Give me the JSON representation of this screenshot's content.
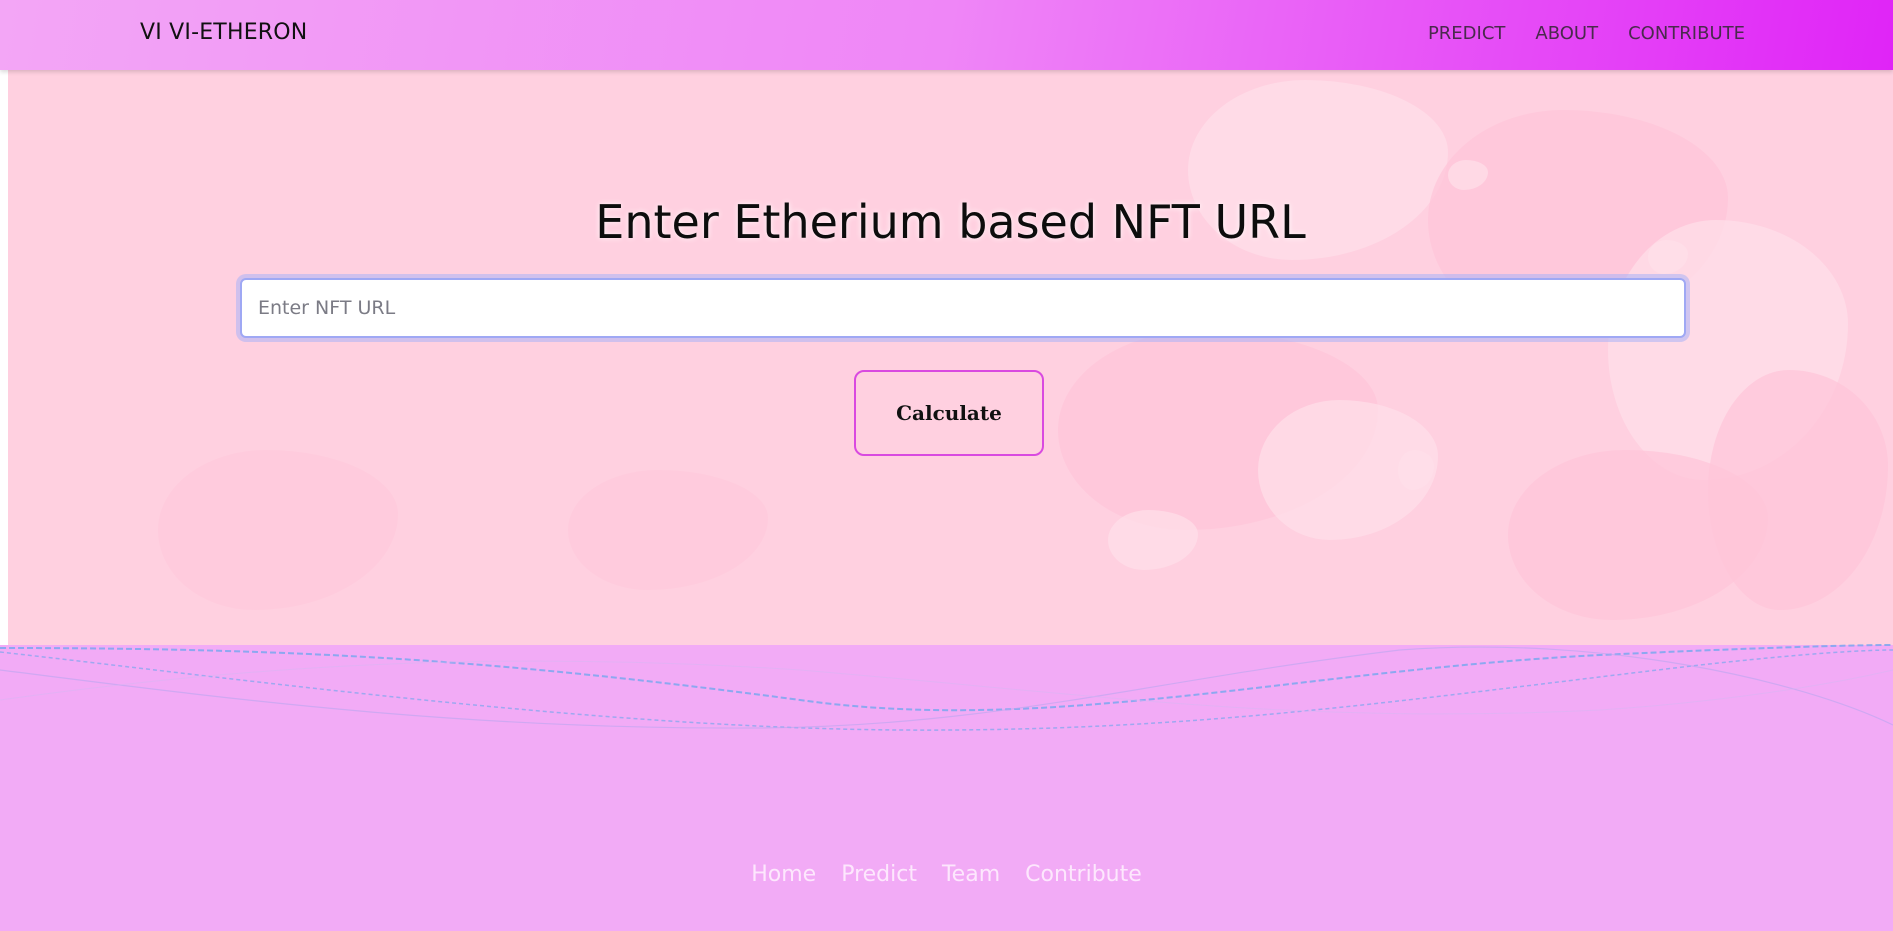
{
  "navbar": {
    "brand": "VI VI-ETHERON",
    "links": [
      "PREDICT",
      "ABOUT",
      "CONTRIBUTE"
    ]
  },
  "hero": {
    "title": "Enter Etherium based NFT URL",
    "input": {
      "placeholder": "Enter NFT URL",
      "value": ""
    },
    "button_label": "Calculate"
  },
  "footer": {
    "links": [
      "Home",
      "Predict",
      "Team",
      "Contribute"
    ]
  },
  "colors": {
    "navbar_gradient_start": "#f3a6f6",
    "navbar_gradient_end": "#e024f7",
    "hero_background": "#ffd0e0",
    "footer_background": "#f2abf6",
    "button_border": "#d94ae0",
    "input_focus_ring": "#aab2f8"
  }
}
